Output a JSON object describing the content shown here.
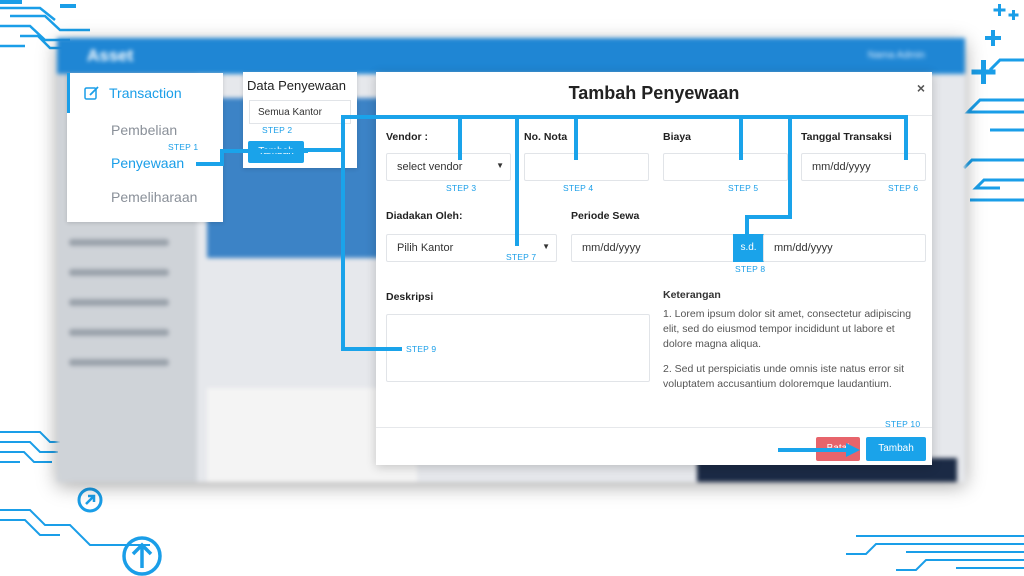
{
  "background_app": {
    "title": "Asset",
    "user": "Nama Admin"
  },
  "side_menu": {
    "title": "Transaction",
    "items": [
      {
        "label": "Pembelian"
      },
      {
        "label": "Penyewaan"
      },
      {
        "label": "Pemeliharaan"
      }
    ]
  },
  "data_penyewaan": {
    "title": "Data Penyewaan",
    "filter_value": "Semua Kantor",
    "add_button": "Tambah"
  },
  "modal": {
    "title": "Tambah Penyewaan",
    "close": "×",
    "vendor": {
      "label": "Vendor :",
      "value": "select vendor"
    },
    "no_nota": {
      "label": "No. Nota",
      "value": ""
    },
    "biaya": {
      "label": "Biaya",
      "value": ""
    },
    "tanggal_transaksi": {
      "label": "Tanggal Transaksi",
      "placeholder": "mm/dd/yyyy"
    },
    "diadakan_oleh": {
      "label": "Diadakan Oleh:",
      "value": "Pilih Kantor"
    },
    "periode_sewa": {
      "label": "Periode Sewa",
      "start_placeholder": "mm/dd/yyyy",
      "separator": "s.d.",
      "end_placeholder": "mm/dd/yyyy"
    },
    "deskripsi": {
      "label": "Deskripsi",
      "value": ""
    },
    "keterangan": {
      "title": "Keterangan",
      "items": [
        "1. Lorem ipsum dolor sit amet, consectetur adipiscing elit, sed do eiusmod tempor incididunt ut labore et dolore magna aliqua.",
        "2. Sed ut perspiciatis unde omnis iste natus error sit voluptatem accusantium doloremque laudantium."
      ]
    },
    "batal_button": "Batal",
    "tambah_button": "Tambah"
  },
  "steps": [
    "STEP 1",
    "STEP 2",
    "STEP 3",
    "STEP 4",
    "STEP 5",
    "STEP 6",
    "STEP 7",
    "STEP 8",
    "STEP 9",
    "STEP 10"
  ],
  "colors": {
    "accent": "#1a9ee8",
    "danger": "#e5545c",
    "header_bar": "#1f86d4"
  }
}
